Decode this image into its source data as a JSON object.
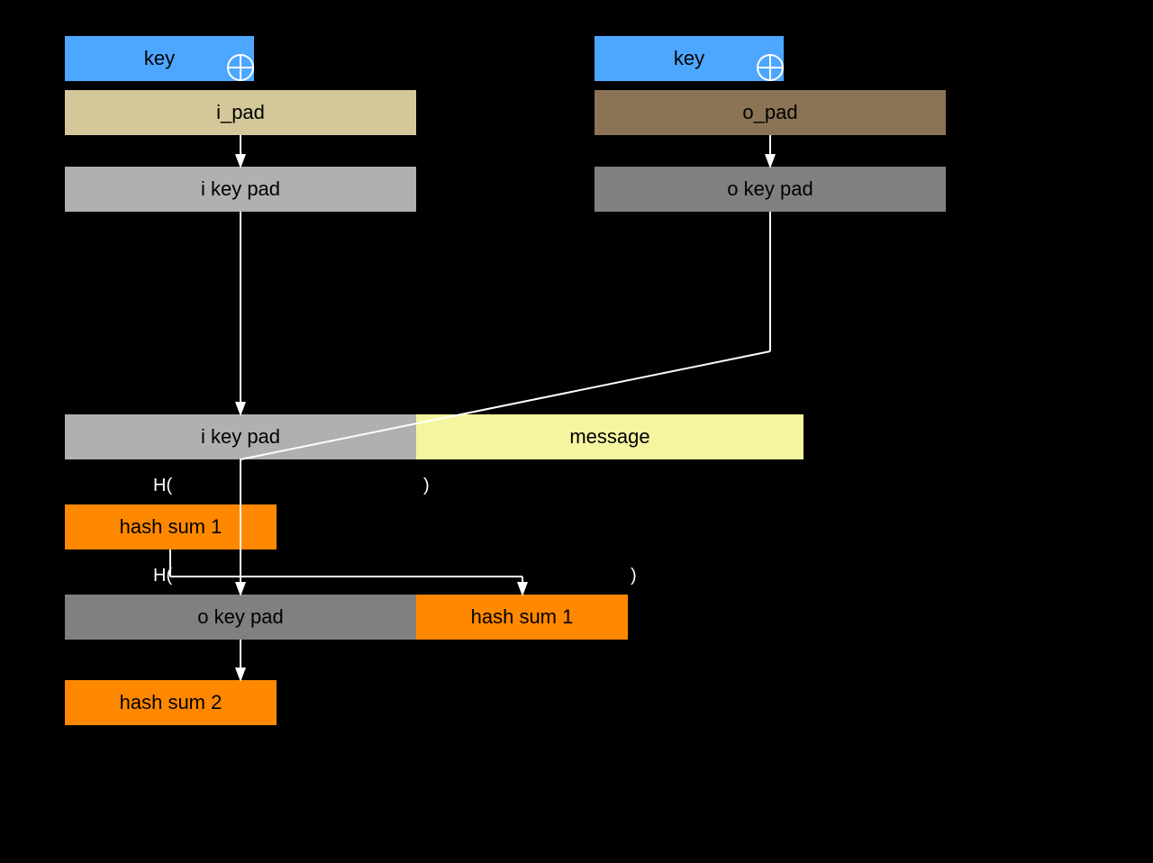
{
  "background": "#000000",
  "accent_blue": "#4da6ff",
  "accent_ipad": "#d4c89a",
  "accent_opad": "#8b7355",
  "accent_grey": "#b0b0b0",
  "accent_grey2": "#808080",
  "accent_yellow": "#f5f5a0",
  "accent_orange": "#ff8800",
  "labels": {
    "key_left": "key",
    "key_right": "key",
    "ipad": "i_pad",
    "opad": "o_pad",
    "ikey_pad_top_left": "i key pad",
    "okey_pad_top_right": "o key pad",
    "ikey_pad_mid": "i key pad",
    "okey_pad_mid": "o key pad",
    "message": "message",
    "hash_sum_1_first": "hash sum 1",
    "hash_sum_1_second": "hash sum 1",
    "hash_sum_2": "hash sum 2"
  }
}
